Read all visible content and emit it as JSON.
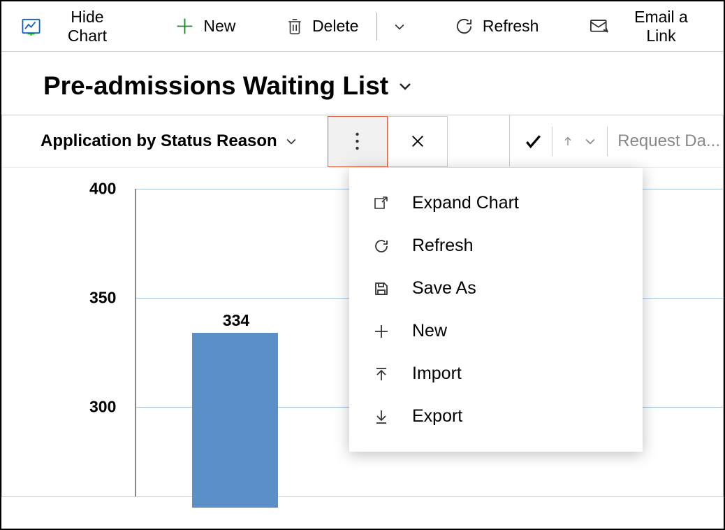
{
  "toolbar": {
    "hide_chart": "Hide Chart",
    "new": "New",
    "delete": "Delete",
    "refresh": "Refresh",
    "email_link": "Email a Link"
  },
  "page": {
    "title": "Pre-admissions Waiting List"
  },
  "chart": {
    "title": "Application by Status Reason",
    "menu": {
      "expand_chart": "Expand Chart",
      "refresh": "Refresh",
      "save_as": "Save As",
      "new": "New",
      "import": "Import",
      "export": "Export"
    }
  },
  "search": {
    "placeholder": "Request Da..."
  },
  "chart_data": {
    "type": "bar",
    "ylim": [
      270,
      400
    ],
    "y_ticks": [
      300,
      350,
      400
    ],
    "series": [
      {
        "label": "334",
        "value": 334,
        "color": "#5b8fc7"
      }
    ]
  }
}
